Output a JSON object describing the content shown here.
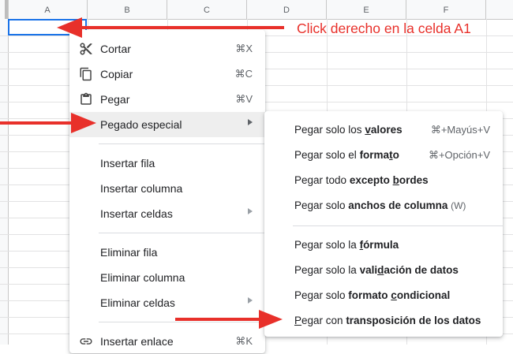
{
  "spreadsheet": {
    "columns": [
      "A",
      "B",
      "C",
      "D",
      "E",
      "F"
    ],
    "selected_cell": "A1"
  },
  "annotation": {
    "text": "Click derecho en la celda A1",
    "color": "#e8302a"
  },
  "context_menu": {
    "items": [
      {
        "label": "Cortar",
        "shortcut": "⌘X",
        "icon": "scissors-icon"
      },
      {
        "label": "Copiar",
        "shortcut": "⌘C",
        "icon": "copy-icon"
      },
      {
        "label": "Pegar",
        "shortcut": "⌘V",
        "icon": "clipboard-icon"
      },
      {
        "label": "Pegado especial",
        "icon": "chevron-right-icon"
      },
      {
        "label": "Insertar fila"
      },
      {
        "label": "Insertar columna"
      },
      {
        "label": "Insertar celdas",
        "icon": "chevron-right-icon"
      },
      {
        "label": "Eliminar fila"
      },
      {
        "label": "Eliminar columna"
      },
      {
        "label": "Eliminar celdas",
        "icon": "chevron-right-icon"
      },
      {
        "label": "Insertar enlace",
        "shortcut": "⌘K",
        "icon": "link-icon"
      }
    ]
  },
  "paste_special_submenu": {
    "items": [
      {
        "pre": "Pegar solo los ",
        "u_pre": "",
        "u": "v",
        "bold": "alores",
        "shortcut": "⌘+Mayús+V"
      },
      {
        "pre": "Pegar solo el ",
        "bold_pre": "forma",
        "u": "t",
        "bold": "o",
        "shortcut": "⌘+Opción+V"
      },
      {
        "pre": "Pegar todo ",
        "bold_pre": "excepto ",
        "u": "b",
        "bold": "ordes"
      },
      {
        "pre": "Pegar solo ",
        "bold": "anchos de columna",
        "hint": "(W)"
      },
      {
        "pre": "Pegar solo la ",
        "u": "f",
        "bold": "órmula"
      },
      {
        "pre": "Pegar solo la ",
        "bold_pre": "vali",
        "u": "d",
        "bold": "ación de datos"
      },
      {
        "pre": "Pegar solo ",
        "bold_pre": "formato ",
        "u": "c",
        "bold": "ondicional"
      },
      {
        "u_pre": "P",
        "pre": "egar con ",
        "bold": "transposición de los datos"
      }
    ]
  }
}
